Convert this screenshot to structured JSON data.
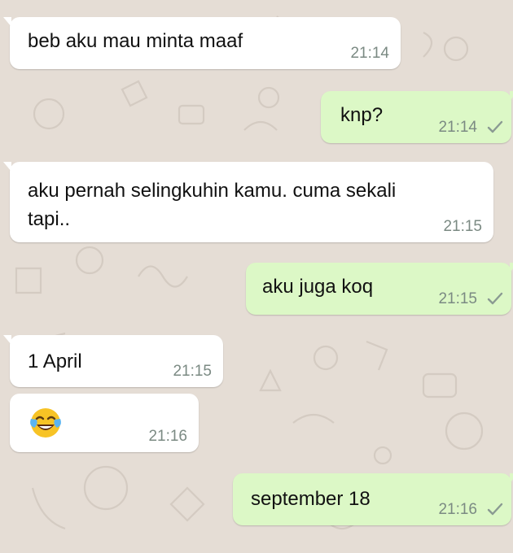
{
  "messages": [
    {
      "direction": "incoming",
      "text": "beb aku mau minta maaf",
      "time": "21:14"
    },
    {
      "direction": "outgoing",
      "text": "knp?",
      "time": "21:14",
      "status": "sent-check-icon"
    },
    {
      "direction": "incoming",
      "text_lines": [
        "aku pernah selingkuhin kamu. cuma sekali",
        "tapi.."
      ],
      "time": "21:15"
    },
    {
      "direction": "outgoing",
      "text": "aku juga koq",
      "time": "21:15",
      "status": "sent-check-icon"
    },
    {
      "direction": "incoming",
      "text": "1 April",
      "time": "21:15"
    },
    {
      "direction": "incoming",
      "emoji": "face-with-tears-of-joy",
      "time": "21:16"
    },
    {
      "direction": "outgoing",
      "text": "september 18",
      "time": "21:16",
      "status": "sent-check-icon"
    }
  ],
  "colors": {
    "background": "#e5ddd5",
    "incoming_bubble": "#ffffff",
    "outgoing_bubble": "#dcf8c6",
    "timestamp": "#7b8a83"
  }
}
